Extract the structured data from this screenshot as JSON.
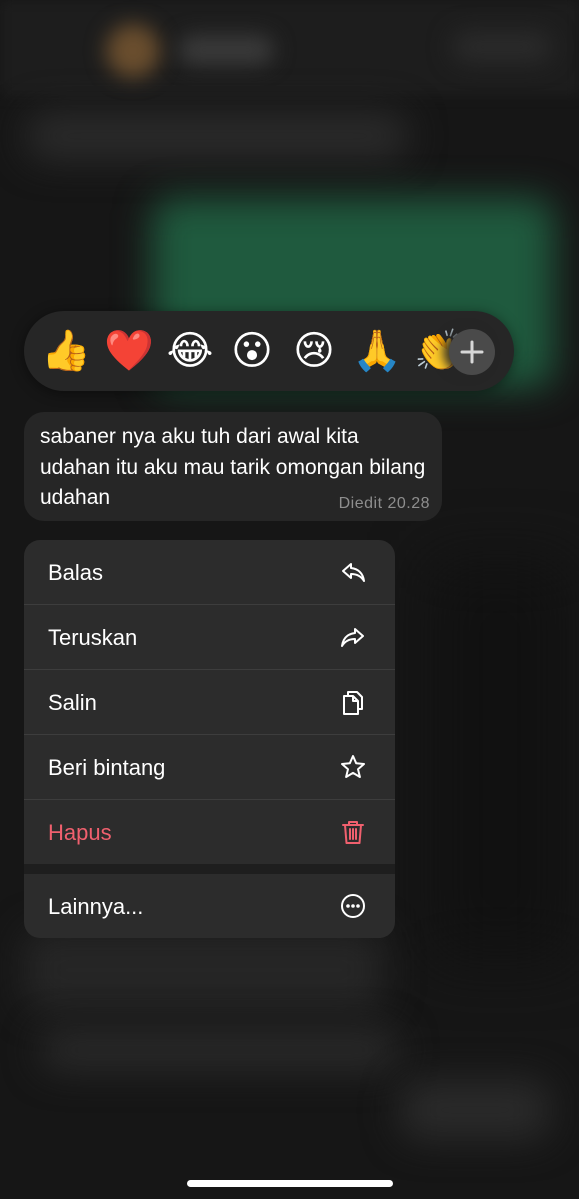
{
  "reactions": {
    "emojis": [
      "👍",
      "❤️",
      "😂",
      "😮",
      "😢",
      "🙏",
      "👏"
    ],
    "more_icon": "plus-icon"
  },
  "message": {
    "text": "sabaner nya aku tuh dari awal kita udahan itu aku mau tarik omongan bilang udahan",
    "timestamp": "Diedit 20.28"
  },
  "menu": {
    "reply_label": "Balas",
    "forward_label": "Teruskan",
    "copy_label": "Salin",
    "star_label": "Beri bintang",
    "delete_label": "Hapus",
    "more_label": "Lainnya...",
    "delete_color": "#f0606e"
  }
}
